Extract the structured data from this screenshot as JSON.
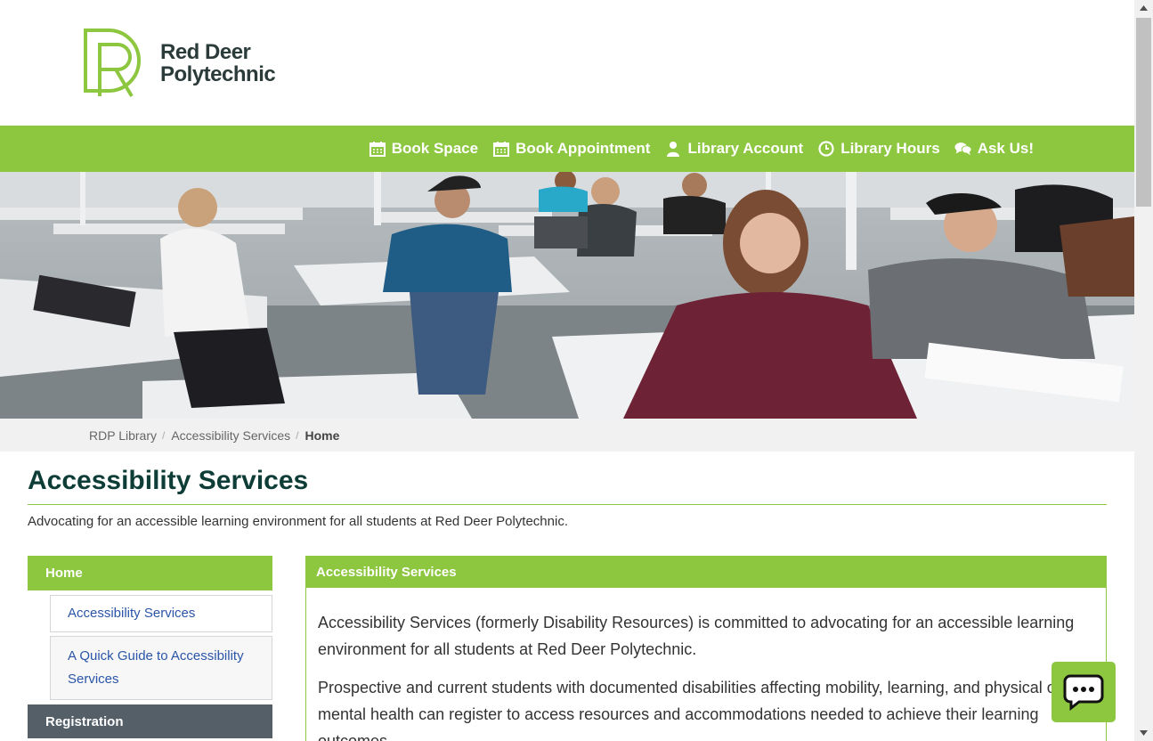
{
  "brand": {
    "line1": "Red Deer",
    "line2": "Polytechnic",
    "accent": "#8dc63f",
    "dark": "#0d3d36"
  },
  "nav": [
    {
      "label": "Book Space",
      "icon": "calendar-icon"
    },
    {
      "label": "Book Appointment",
      "icon": "calendar-icon"
    },
    {
      "label": "Library Account",
      "icon": "user-icon"
    },
    {
      "label": "Library Hours",
      "icon": "clock-icon"
    },
    {
      "label": "Ask Us!",
      "icon": "chat-bubbles-icon"
    }
  ],
  "breadcrumb": {
    "item1": "RDP Library",
    "item2": "Accessibility Services",
    "current": "Home"
  },
  "page": {
    "title": "Accessibility Services",
    "description": "Advocating for an accessible learning environment for all students at Red Deer Polytechnic."
  },
  "sidebar": {
    "home": "Home",
    "sub1": "Accessibility Services",
    "sub2": "A Quick Guide to Accessibility Services",
    "registration": "Registration"
  },
  "box": {
    "heading": "Accessibility Services",
    "p1": "Accessibility Services (formerly Disability Resources) is committed to advocating for an accessible learning environment for all students at Red Deer Polytechnic.",
    "p2": "Prospective and current students with documented disabilities affecting mobility, learning, and physical or mental health can register to access resources and accommodations needed to achieve their learning outcomes."
  },
  "chat": {
    "icon": "chat-icon"
  }
}
